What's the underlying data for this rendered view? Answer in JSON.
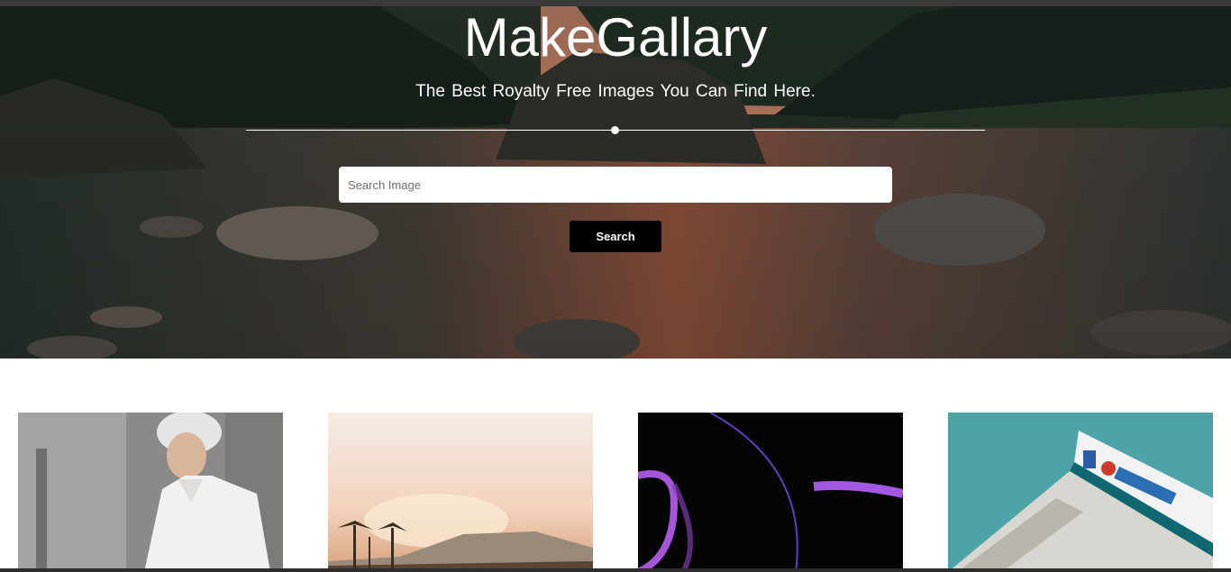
{
  "hero": {
    "title": "MakeGallary",
    "subtitle": "The Best Royalty Free Images You Can Find Here.",
    "search_placeholder": "Search Image",
    "search_button_label": "Search"
  },
  "gallery": {
    "images": [
      {
        "name": "woman-in-white-shirt-photo"
      },
      {
        "name": "sunset-palm-trees-photo"
      },
      {
        "name": "abstract-purple-waves-photo"
      },
      {
        "name": "gas-station-canopy-photo"
      }
    ]
  },
  "colors": {
    "button_bg": "#000000",
    "text_white": "#ffffff"
  }
}
